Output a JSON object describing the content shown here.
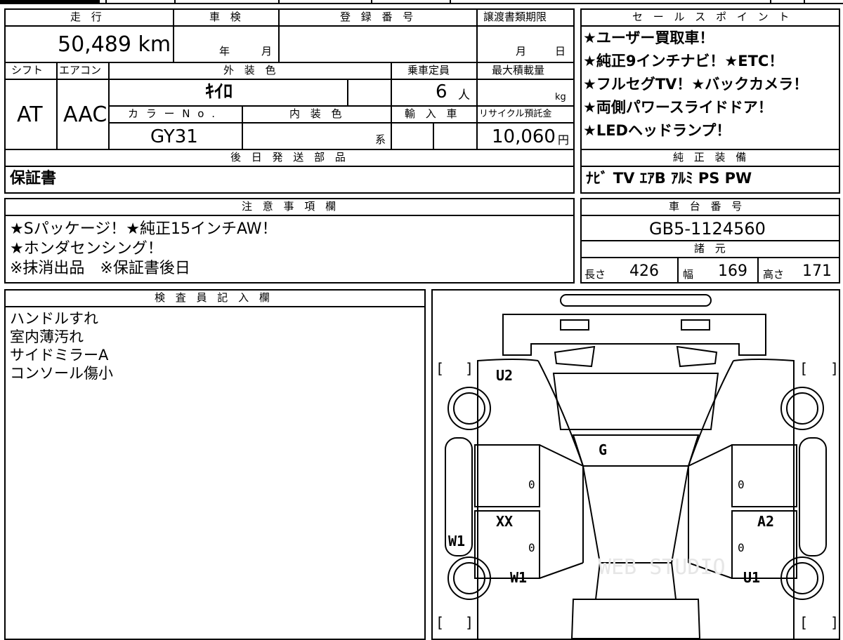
{
  "top": {
    "mileage_label": "走 行",
    "mileage_value": "50,489 km",
    "inspection_label": "車 検",
    "inspection_year": "年",
    "inspection_month": "月",
    "registration_label": "登 録 番 号",
    "transfer_label": "譲渡書類期限",
    "transfer_month": "月",
    "transfer_day": "日"
  },
  "spec": {
    "shift_label": "シフト",
    "shift_value": "AT",
    "ac_label": "エアコン",
    "ac_value": "AAC",
    "exterior_label": "外 装 色",
    "exterior_value": "ｷｲﾛ",
    "seating_label": "乗車定員",
    "seating_value": "6",
    "seating_unit": "人",
    "maxload_label": "最大積載量",
    "maxload_unit": "kg",
    "colorno_label": "カ ラ ー N o .",
    "colorno_value": "GY31",
    "interior_label": "内 装 色",
    "interior_suffix": "系",
    "import_label": "輸 入 車",
    "recycle_label": "リサイクル預託金",
    "recycle_value": "10,060",
    "recycle_unit": "円"
  },
  "shipping": {
    "label": "後 日 発 送 部 品",
    "value": "保証書"
  },
  "sales_points": {
    "label": "セ ー ル ス ポ イ ン ト",
    "lines": [
      "★ユーザー買取車！",
      "★純正9インチナビ！★ETC！",
      "★フルセグTV！★バックカメラ！",
      "★両側パワースライドドア！",
      "★LEDヘッドランプ！"
    ]
  },
  "equipment": {
    "label": "純 正 装 備",
    "value": "ﾅﾋﾞ TV ｴｱB ｱﾙﾐ PS PW"
  },
  "notes": {
    "label": "注 意 事 項 欄",
    "lines": [
      "★Sパッケージ！★純正15インチAW！",
      "★ホンダセンシング！",
      "※抹消出品　※保証書後日"
    ]
  },
  "chassis": {
    "label": "車 台 番 号",
    "value": "GB5-1124560"
  },
  "dimensions": {
    "label": "諸 元",
    "length_label": "長さ",
    "length_value": "426",
    "width_label": "幅",
    "width_value": "169",
    "height_label": "高さ",
    "height_value": "171"
  },
  "inspector": {
    "label": "検 査 員 記 入 欄",
    "lines": [
      "ハンドルすれ",
      "室内薄汚れ",
      "サイドミラーA",
      "コンソール傷小"
    ]
  },
  "diagram": {
    "marks": {
      "u2": "U2",
      "g": "G",
      "xx": "XX",
      "a2": "A2",
      "w1_side": "W1",
      "w1_rear": "W1",
      "u1": "U1",
      "zero1": "0",
      "zero2": "0",
      "zero3": "0",
      "zero4": "0"
    },
    "watermark": "WEB STUDIO"
  }
}
